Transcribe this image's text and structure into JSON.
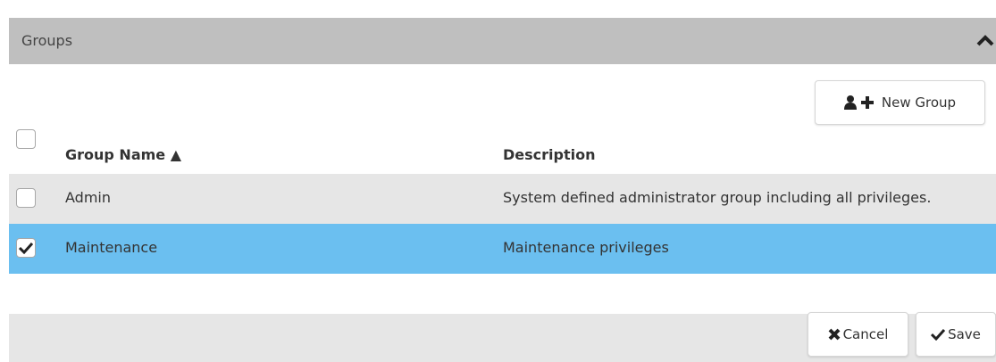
{
  "panel": {
    "title": "Groups",
    "collapse_icon": "chevron-up-icon"
  },
  "toolbar": {
    "new_group_label": "New Group",
    "new_group_icon": "add-user-icon"
  },
  "table": {
    "headers": {
      "name": "Group Name ▲",
      "description": "Description"
    },
    "rows": [
      {
        "name": "Admin",
        "description": "System defined administrator group including all privileges.",
        "checked": false
      },
      {
        "name": "Maintenance",
        "description": "Maintenance privileges",
        "checked": true
      }
    ]
  },
  "footer": {
    "cancel_label": "Cancel",
    "save_label": "Save",
    "cancel_icon": "x-icon",
    "save_icon": "checkmark-icon"
  },
  "colors": {
    "header_bg": "#bfbfbf",
    "selected_row": "#6bbff0",
    "row_alt": "#e6e6e6"
  }
}
